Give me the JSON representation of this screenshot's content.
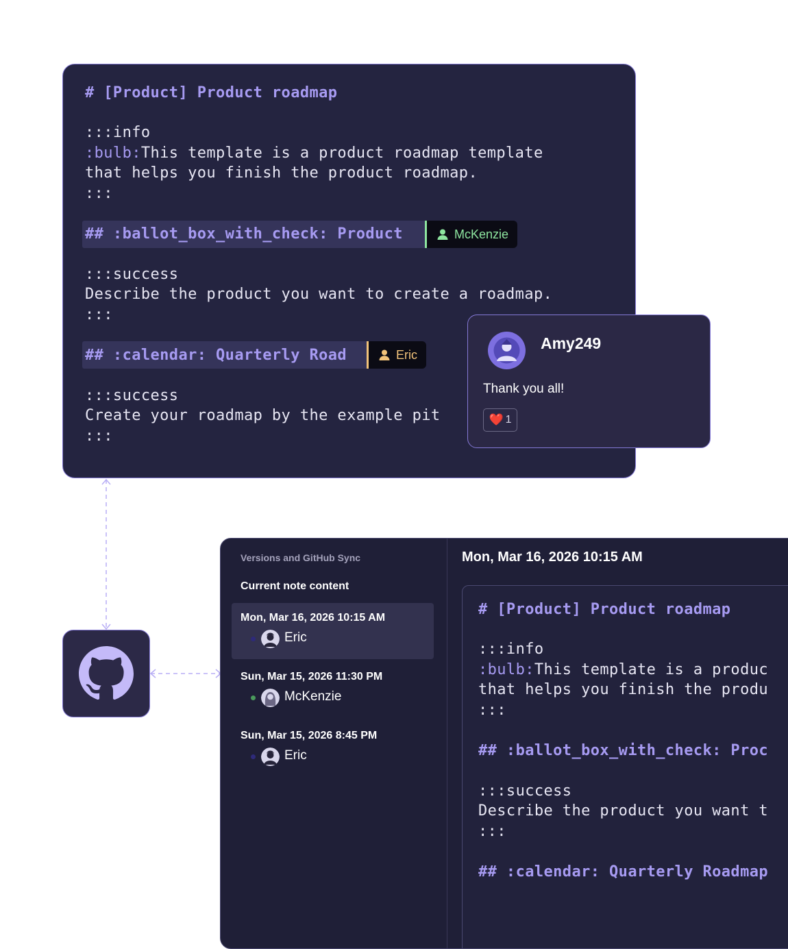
{
  "top_editor": {
    "lines": {
      "title": "# [Product] Product roadmap",
      "info_open": ":::info",
      "bulb_token": ":bulb:",
      "bulb_text": "This template is a product roadmap template",
      "bulb_text2": "that helps you finish the product roadmap.",
      "close1": ":::",
      "heading1": "## :ballot_box_with_check: Product",
      "success1_open": ":::success",
      "success1_text": "Describe the product you want to create a roadmap.",
      "close2": ":::",
      "heading2": "## :calendar: Quarterly Road",
      "success2_open": ":::success",
      "success2_text": "Create your roadmap by the example pit",
      "close3": ":::"
    },
    "cursors": [
      {
        "user": "McKenzie",
        "color": "#8ee6a0"
      },
      {
        "user": "Eric",
        "color": "#f2c37a"
      }
    ]
  },
  "comment": {
    "author": "Amy249",
    "message": "Thank you all!",
    "reaction_emoji": "❤️",
    "reaction_count": "1"
  },
  "github_icon": "github-icon",
  "versions_panel": {
    "title": "Versions and GitHub Sync",
    "current": "Current note content",
    "versions": [
      {
        "date": "Mon, Mar 16, 2026 10:15 AM",
        "user": "Eric",
        "dot_color": "#2e2a7a"
      },
      {
        "date": "Sun, Mar 15, 2026 11:30 PM",
        "user": "McKenzie",
        "dot_color": "#4a9a5c"
      },
      {
        "date": "Sun, Mar 15, 2026 8:45 PM",
        "user": "Eric",
        "dot_color": "#2e2a7a"
      }
    ],
    "detail_date": "Mon, Mar 16, 2026 10:15 AM",
    "preview": {
      "title": "# [Product] Product roadmap",
      "info_open": ":::info",
      "bulb_token": ":bulb:",
      "bulb_text": "This template is a produc",
      "bulb_text2": "that helps you finish the produ",
      "close1": ":::",
      "heading1": "## :ballot_box_with_check: Proc",
      "success1_open": ":::success",
      "success1_text": "Describe the product you want t",
      "close2": ":::",
      "heading2": "## :calendar: Quarterly Roadmap"
    }
  }
}
